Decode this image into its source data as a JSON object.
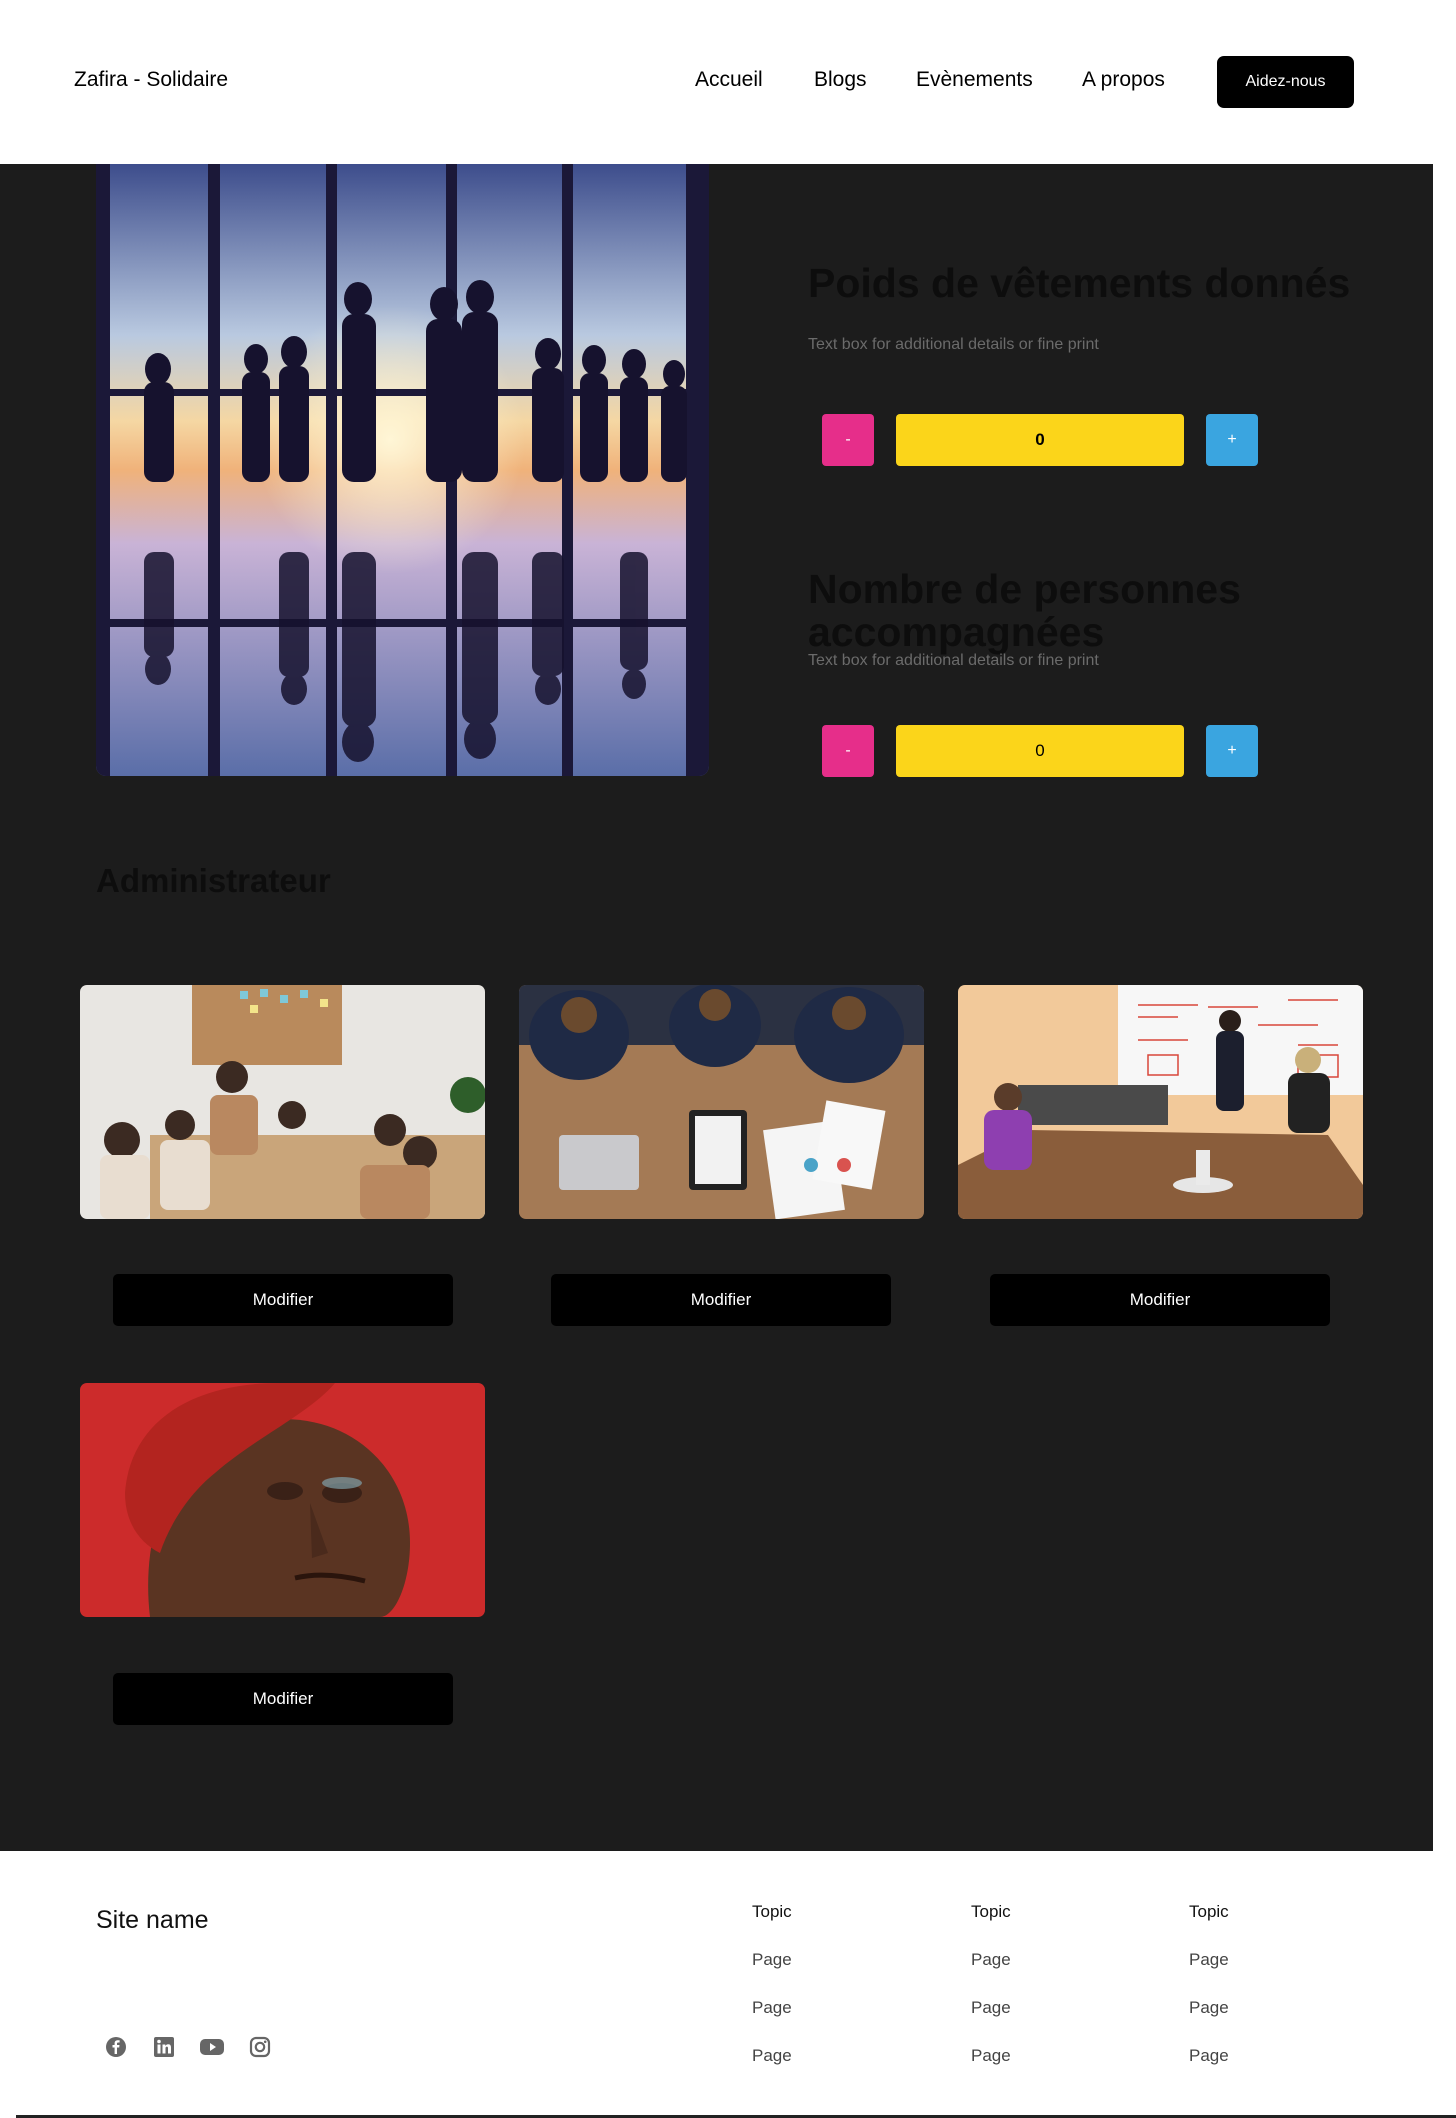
{
  "header": {
    "brand": "Zafira - Solidaire",
    "nav": [
      "Accueil",
      "Blogs",
      "Evènements",
      "A propos"
    ],
    "cta_label": "Aidez-nous"
  },
  "stats": [
    {
      "title": "Poids de vêtements donnés",
      "fineprint": "Text box for additional details or fine print",
      "minus_label": "-",
      "value": "0",
      "plus_label": "+"
    },
    {
      "title": "Nombre de personnes accompagnées",
      "fineprint": "Text box for additional details or fine print",
      "minus_label": "-",
      "value": "0",
      "plus_label": "+"
    }
  ],
  "admin": {
    "title": "Administrateur",
    "cards": [
      {
        "button_label": "Modifier"
      },
      {
        "button_label": "Modifier"
      },
      {
        "button_label": "Modifier"
      },
      {
        "button_label": "Modifier"
      }
    ]
  },
  "footer": {
    "site_name": "Site name",
    "columns": [
      {
        "topic": "Topic",
        "pages": [
          "Page",
          "Page",
          "Page"
        ]
      },
      {
        "topic": "Topic",
        "pages": [
          "Page",
          "Page",
          "Page"
        ]
      },
      {
        "topic": "Topic",
        "pages": [
          "Page",
          "Page",
          "Page"
        ]
      }
    ],
    "social_icons": [
      "facebook-icon",
      "linkedin-icon",
      "youtube-icon",
      "instagram-icon"
    ]
  },
  "colors": {
    "background_dark": "#1c1c1c",
    "minus": "#e62e8a",
    "counter": "#fbd51a",
    "plus": "#3aa5e0"
  }
}
